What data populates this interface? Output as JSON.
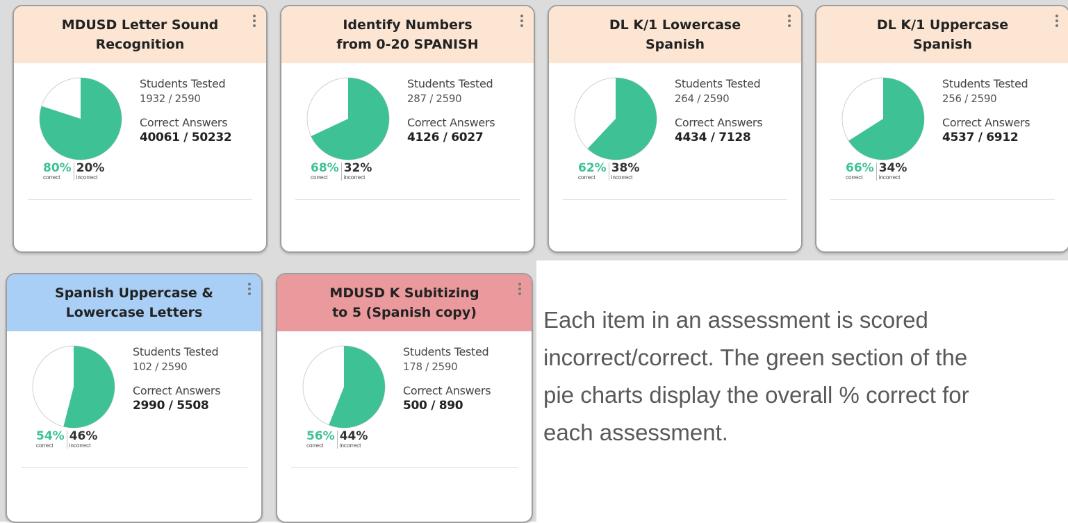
{
  "cards": [
    {
      "title": "MDUSD Letter Sound\nRecognition",
      "header_color": "#fce6d3",
      "students_label": "Students Tested",
      "students": "1932 / 2590",
      "correct_label": "Correct Answers",
      "correct": "40061 / 50232",
      "pct_correct": "80%",
      "pct_incorrect": "20%",
      "correct_caption": "correct",
      "incorrect_caption": "incorrect",
      "correct_fraction": 0.8
    },
    {
      "title": "Identify Numbers\nfrom 0-20 SPANISH",
      "header_color": "#fce6d3",
      "students_label": "Students Tested",
      "students": "287 / 2590",
      "correct_label": "Correct Answers",
      "correct": "4126 / 6027",
      "pct_correct": "68%",
      "pct_incorrect": "32%",
      "correct_caption": "correct",
      "incorrect_caption": "incorrect",
      "correct_fraction": 0.68
    },
    {
      "title": "DL K/1 Lowercase\nSpanish",
      "header_color": "#fce6d3",
      "students_label": "Students Tested",
      "students": "264 / 2590",
      "correct_label": "Correct Answers",
      "correct": "4434 / 7128",
      "pct_correct": "62%",
      "pct_incorrect": "38%",
      "correct_caption": "correct",
      "incorrect_caption": "incorrect",
      "correct_fraction": 0.62
    },
    {
      "title": "DL K/1 Uppercase\nSpanish",
      "header_color": "#fce6d3",
      "students_label": "Students Tested",
      "students": "256 / 2590",
      "correct_label": "Correct Answers",
      "correct": "4537 / 6912",
      "pct_correct": "66%",
      "pct_incorrect": "34%",
      "correct_caption": "correct",
      "incorrect_caption": "incorrect",
      "correct_fraction": 0.66
    },
    {
      "title": "Spanish Uppercase &\nLowercase Letters",
      "header_color": "#a9cff7",
      "students_label": "Students Tested",
      "students": "102 / 2590",
      "correct_label": "Correct Answers",
      "correct": "2990 / 5508",
      "pct_correct": "54%",
      "pct_incorrect": "46%",
      "correct_caption": "correct",
      "incorrect_caption": "incorrect",
      "correct_fraction": 0.54
    },
    {
      "title": "MDUSD K Subitizing\nto 5 (Spanish copy)",
      "header_color": "#ea9a9c",
      "students_label": "Students Tested",
      "students": "178 / 2590",
      "correct_label": "Correct Answers",
      "correct": "500 / 890",
      "pct_correct": "56%",
      "pct_incorrect": "44%",
      "correct_caption": "correct",
      "incorrect_caption": "incorrect",
      "correct_fraction": 0.56
    }
  ],
  "colors": {
    "correct": "#3ec195",
    "incorrect": "#ffffff",
    "pie_outline": "#d0d0d0"
  },
  "note": {
    "lines": [
      "Each item in an assessment is scored",
      "incorrect/correct.  The green section of the",
      "pie charts display the overall % correct for",
      "each assessment."
    ]
  }
}
